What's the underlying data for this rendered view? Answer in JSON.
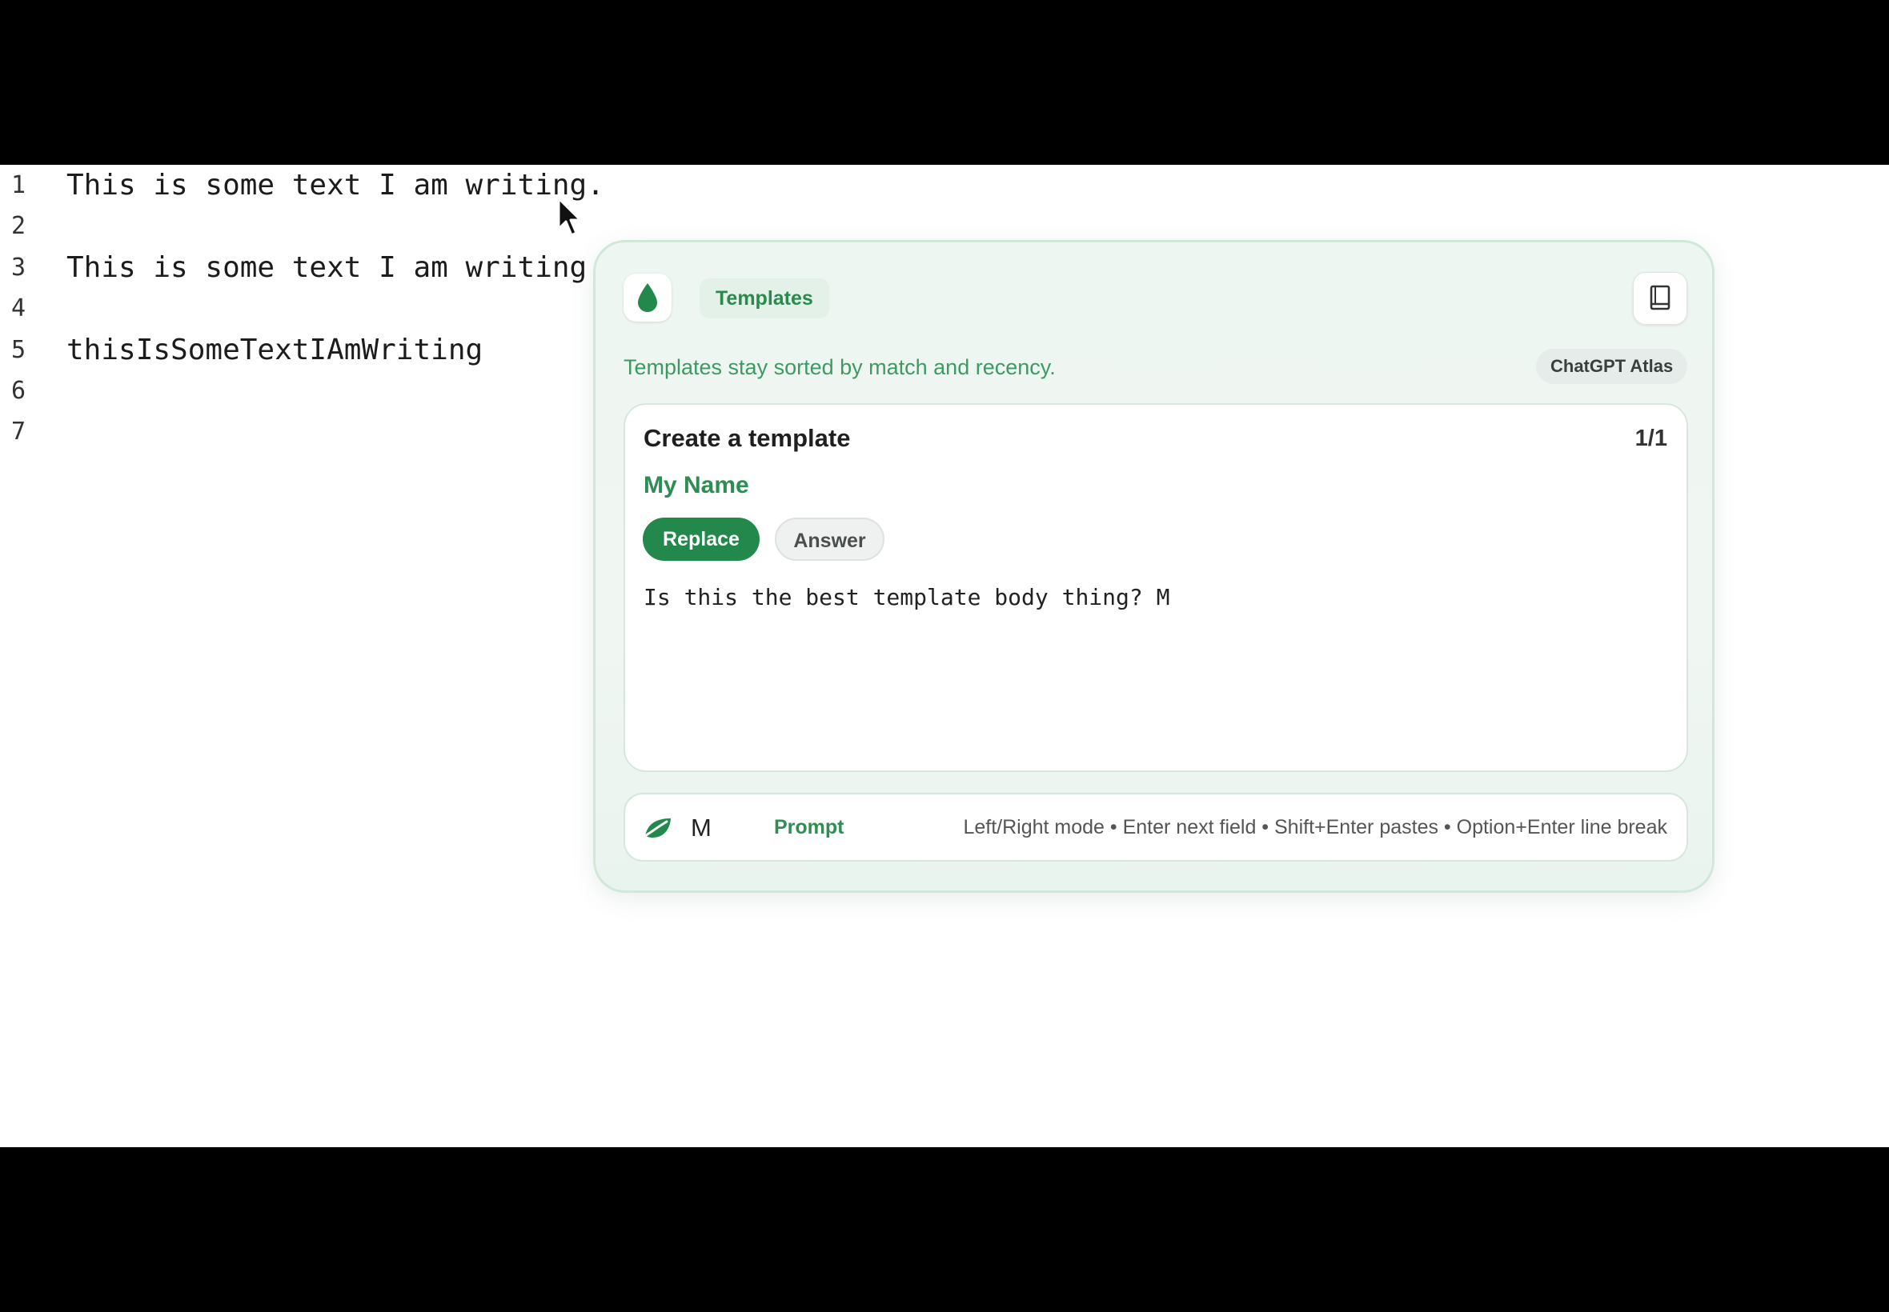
{
  "editor": {
    "lines": [
      {
        "number": "1",
        "text": "This is some text I am writing."
      },
      {
        "number": "2",
        "text": ""
      },
      {
        "number": "3",
        "text": "This is some text I am writing"
      },
      {
        "number": "4",
        "text": ""
      },
      {
        "number": "5",
        "text": "thisIsSomeTextIAmWriting"
      },
      {
        "number": "6",
        "text": ""
      },
      {
        "number": "7",
        "text": ""
      }
    ]
  },
  "popup": {
    "logo_icon": "droplet-icon",
    "tab_label": "Templates",
    "book_icon": "book-icon",
    "subtitle": "Templates stay sorted by match and recency.",
    "source_badge": "ChatGPT Atlas",
    "card": {
      "title": "Create a template",
      "count": "1/1",
      "template_name": "My Name",
      "modes": {
        "replace": "Replace",
        "answer": "Answer"
      },
      "selected_mode": "Replace",
      "body": "Is this the best template body thing? M"
    },
    "footer": {
      "icon": "leaf-icon",
      "input_value": "M",
      "mode_label": "Prompt",
      "hint": "Left/Right mode • Enter next field • Shift+Enter pastes • Option+Enter line break"
    }
  },
  "colors": {
    "accent": "#22884b",
    "accent_text": "#2e8d52",
    "popup_bg": "#eef6f1",
    "popup_border": "#cfe8d8"
  }
}
